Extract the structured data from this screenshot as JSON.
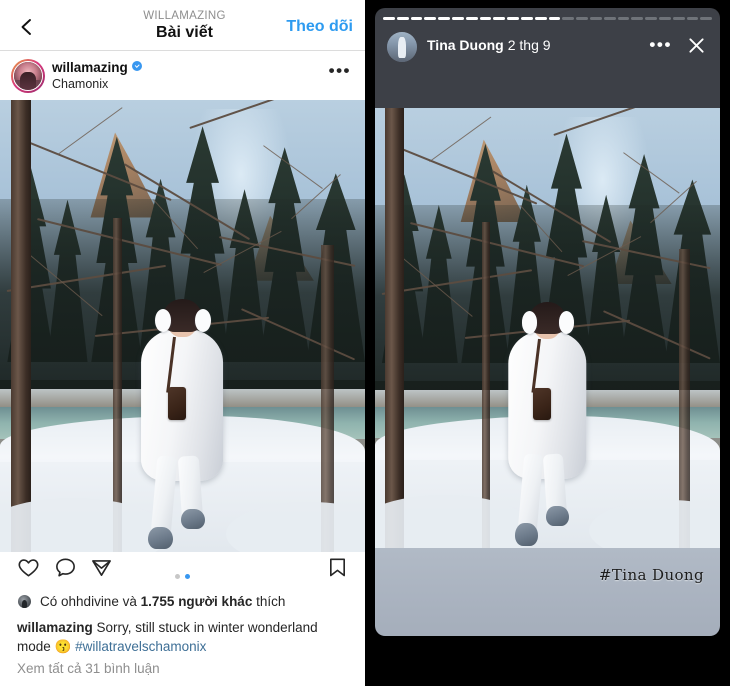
{
  "post": {
    "nav": {
      "back_icon": "chevron-left-icon",
      "kicker": "WILLAMAZING",
      "title": "Bài viết",
      "follow_label": "Theo dõi",
      "follow_color": "#2e9bf0"
    },
    "author": {
      "username": "willamazing",
      "verified": true,
      "location": "Chamonix",
      "more_label": "•••"
    },
    "actions": {
      "like_icon": "heart-icon",
      "comment_icon": "comment-bubble-icon",
      "share_icon": "paper-plane-icon",
      "save_icon": "bookmark-icon",
      "carousel_dots": 2,
      "carousel_active_index": 1,
      "dot_active_color": "#3897f0",
      "dot_inactive_color": "#c7c7c7"
    },
    "likes": {
      "prefix": "Có",
      "liker": "ohhdivine",
      "conjunction": "và",
      "count": "1.755",
      "others": "người khác",
      "suffix": "thích"
    },
    "caption": {
      "username": "willamazing",
      "text": "Sorry, still stuck in winter wonderland mode",
      "emoji": "😗",
      "hashtag": "#willatravelschamonix",
      "hashtag_color": "#3e6f96"
    },
    "comments_link": "Xem tất cả 31 bình luận"
  },
  "story": {
    "progress_total": 24,
    "progress_filled": 13,
    "author_name": "Tina Duong",
    "timestamp": "2 thg 9",
    "more_label": "•••",
    "close_icon": "close-x-icon",
    "watermark": "#Tina Duong",
    "card_bg": "#3d4047",
    "footer_bg": "#aeb7c4"
  },
  "photo": {
    "description": "Woman in white fur coat standing on snow by a turquoise river in a winter forest",
    "sky_color": "#a8c2d8",
    "snow_color": "#eef2f6",
    "river_color": "#8fb3ae",
    "coat_color": "#ffffff",
    "shoe_color": "#6c7a8a"
  }
}
